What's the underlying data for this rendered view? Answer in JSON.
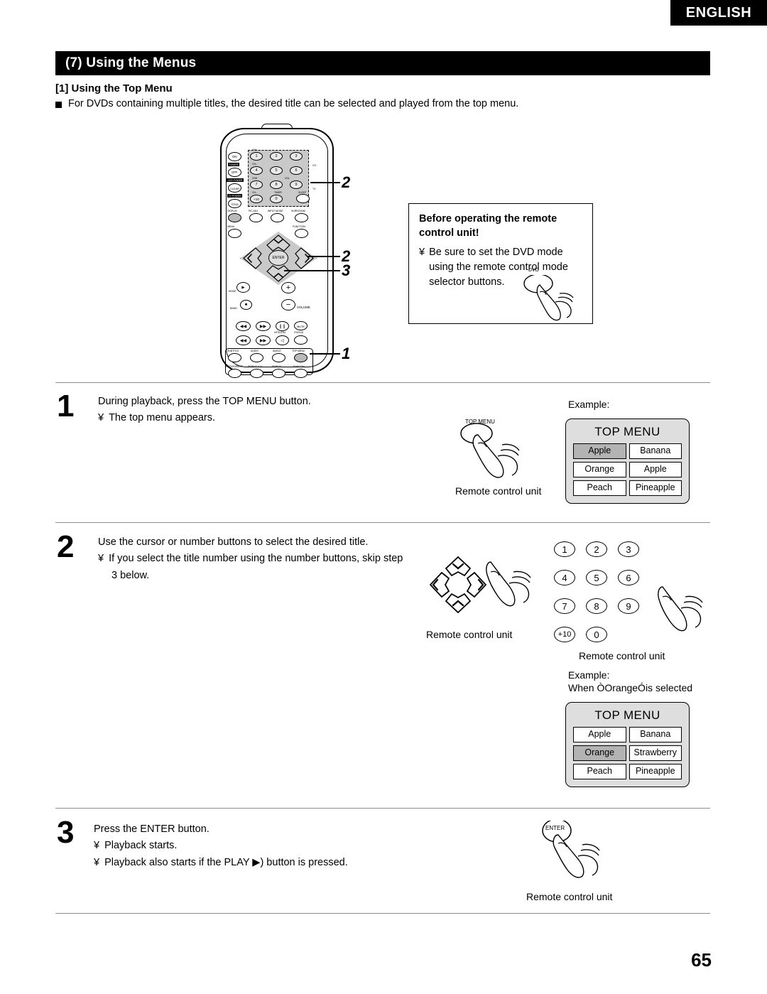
{
  "header": {
    "language_tab": "ENGLISH",
    "section_title": "(7) Using the Menus",
    "subsection_title": "[1] Using the Top Menu",
    "intro_bullet": "For DVDs containing multiple titles, the desired title can be selected and played from the top menu."
  },
  "page_number": "65",
  "remote_diagram": {
    "callouts": [
      "2",
      "2",
      "3",
      "1"
    ],
    "power_buttons": [
      "ON",
      "OFF",
      "CLEAR",
      "CALL"
    ],
    "power_labels": [
      "POWER",
      "VCR POWER",
      "TV POWER"
    ],
    "number_keys": [
      "1",
      "2",
      "3",
      "4",
      "5",
      "6",
      "7",
      "8",
      "9",
      "+10",
      "0"
    ],
    "numpad_top_labels": [
      "CH+",
      "CH–",
      "CH8",
      "CH–"
    ],
    "function_row": [
      "DISPLAY",
      "MENU",
      "PIC ADJ",
      "INPUT MODE",
      "SURROUND",
      "FUNCTION"
    ],
    "transport_labels": [
      "MODE",
      "BAND",
      "VOLUME",
      "STATUS",
      "NTSC/PAL",
      "MUTE"
    ],
    "bottom_row_1": [
      "SUBTITLE",
      "AUDIO",
      "ANGLE",
      "TOP MENU"
    ],
    "bottom_row_2": [
      "PROG/DIRECT",
      "REPEAT A-B",
      "REPEAT",
      "RANDOM"
    ],
    "enter_label": "ENTER",
    "sleep_label": "SLEEP",
    "timer_label": "TIMER",
    "side_labels": [
      "CH",
      "TV",
      "VOL"
    ]
  },
  "note_box": {
    "title_line1": "Before operating the remote",
    "title_line2": "control unit!",
    "bullet_mark": "¥",
    "body_line1": "Be sure to set the DVD mode",
    "body_line2": "using the remote control mode",
    "body_line3": "selector buttons.",
    "button_label": "DVD"
  },
  "steps": [
    {
      "number": "1",
      "line1": "During playback, press the TOP MENU button.",
      "bullet_mark": "¥",
      "line2": "The top menu appears.",
      "press_button_label": "TOP MENU",
      "press_caption": "Remote control unit",
      "example_label": "Example:",
      "screen": {
        "title": "TOP MENU",
        "cells": [
          "Apple",
          "Banana",
          "Orange",
          "Apple",
          "Peach",
          "Pineapple"
        ],
        "selected_index": 0
      }
    },
    {
      "number": "2",
      "line1": "Use the cursor or number buttons to select the desired title.",
      "bullet_mark": "¥",
      "line2": "If you select the title number using the number buttons, skip step",
      "line3": "3 below.",
      "cursor_caption": "Remote control unit",
      "numpad_caption": "Remote control unit",
      "numpad_keys": [
        "1",
        "2",
        "3",
        "4",
        "5",
        "6",
        "7",
        "8",
        "9",
        "+10",
        "0"
      ],
      "example_label": "Example:",
      "example_sub": "When ÒOrangeÓis selected",
      "screen": {
        "title": "TOP MENU",
        "cells": [
          "Apple",
          "Banana",
          "Orange",
          "Strawberry",
          "Peach",
          "Pineapple"
        ],
        "selected_index": 2
      }
    },
    {
      "number": "3",
      "line1": "Press the ENTER button.",
      "bullet_mark": "¥",
      "line2": "Playback starts.",
      "line3_pre": "Playback also starts if the PLAY ",
      "line3_post": ") button is pressed.",
      "press_button_label": "ENTER",
      "press_caption": "Remote control unit"
    }
  ]
}
